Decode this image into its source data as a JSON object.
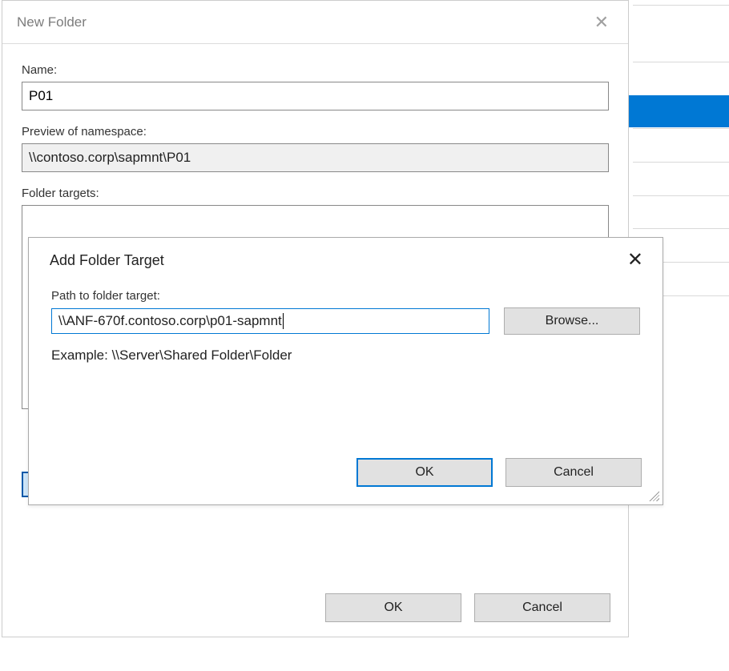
{
  "new_folder": {
    "title": "New Folder",
    "name_label": "Name:",
    "name_value": "P01",
    "preview_label": "Preview of namespace:",
    "preview_value": "\\\\contoso.corp\\sapmnt\\P01",
    "targets_label": "Folder targets:",
    "ok": "OK",
    "cancel": "Cancel"
  },
  "add_target": {
    "title": "Add Folder Target",
    "path_label": "Path to folder target:",
    "path_value": "\\\\ANF-670f.contoso.corp\\p01-sapmnt",
    "browse": "Browse...",
    "example": "Example: \\\\Server\\Shared Folder\\Folder",
    "ok": "OK",
    "cancel": "Cancel"
  }
}
